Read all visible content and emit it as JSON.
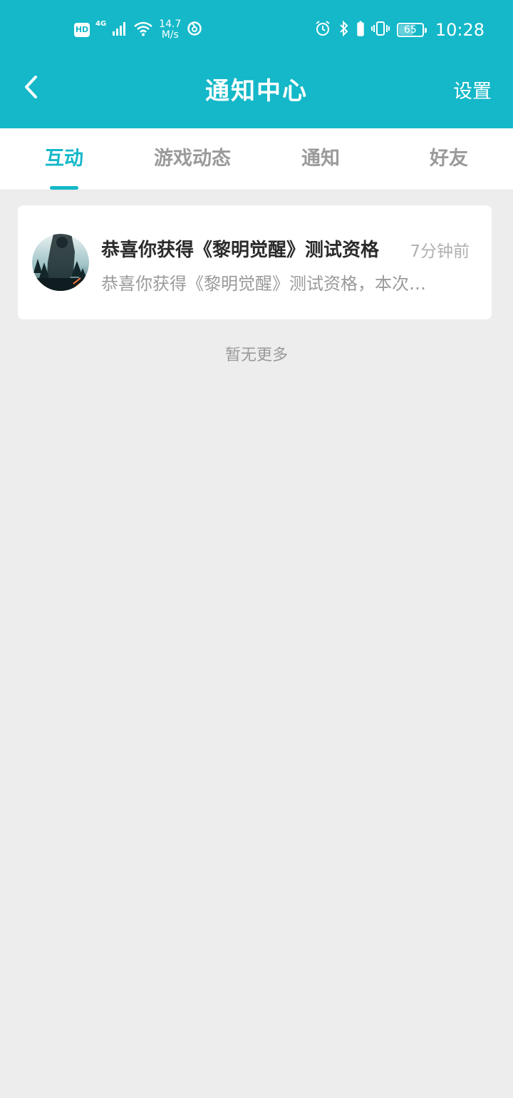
{
  "status_bar": {
    "hd": "HD",
    "network": "4G",
    "speed_value": "14.7",
    "speed_unit": "M/s",
    "battery": "65",
    "battery_level": 0.65,
    "time": "10:28"
  },
  "header": {
    "title": "通知中心",
    "settings_label": "设置",
    "back_icon": "chevron-left-icon"
  },
  "tabs": [
    {
      "label": "互动",
      "active": true
    },
    {
      "label": "游戏动态",
      "active": false
    },
    {
      "label": "通知",
      "active": false
    },
    {
      "label": "好友",
      "active": false
    }
  ],
  "notifications": [
    {
      "title": "恭喜你获得《黎明觉醒》测试资格",
      "time": "7分钟前",
      "summary": "恭喜你获得《黎明觉醒》测试资格，本次…"
    }
  ],
  "footer": {
    "no_more": "暂无更多"
  },
  "colors": {
    "accent": "#14b8c8",
    "background": "#ededed",
    "card": "#ffffff",
    "title_text": "#2b2b2b",
    "muted_text": "#9a9a9a"
  }
}
